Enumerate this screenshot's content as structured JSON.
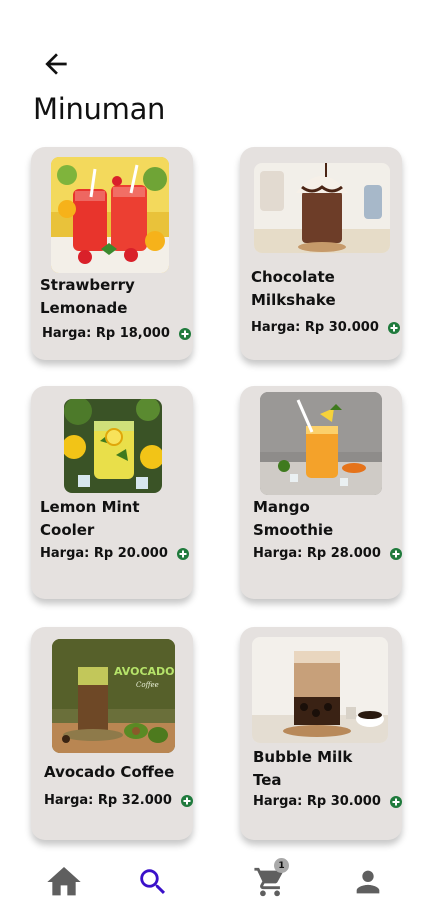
{
  "header": {
    "title": "Minuman"
  },
  "products": [
    {
      "name_line1": "Strawberry",
      "name_line2": "Lemonade",
      "price": "Harga: Rp 18,000"
    },
    {
      "name_line1": "Chocolate",
      "name_line2": "Milkshake",
      "price": "Harga: Rp 30.000"
    },
    {
      "name_line1": "Lemon Mint",
      "name_line2": "Cooler",
      "price": "Harga: Rp 20.000"
    },
    {
      "name_line1": "Mango",
      "name_line2": "Smoothie",
      "price": "Harga: Rp 28.000"
    },
    {
      "name_line1": "Avocado Coffee",
      "name_line2": "",
      "price": "Harga: Rp 32.000",
      "image_text": "AVOCADO",
      "image_subtext": "Coffee"
    },
    {
      "name_line1": "Bubble Milk",
      "name_line2": "Tea",
      "price": "Harga: Rp 30.000"
    }
  ],
  "nav": {
    "items": [
      "home-icon",
      "search-icon",
      "cart-icon",
      "person-icon"
    ],
    "active": "search",
    "cart_count": "1",
    "active_color": "#3a10c9",
    "inactive_color": "#5f5f5f"
  },
  "colors": {
    "card_bg": "#e5e1df",
    "add_button": "#1f7a3c"
  }
}
